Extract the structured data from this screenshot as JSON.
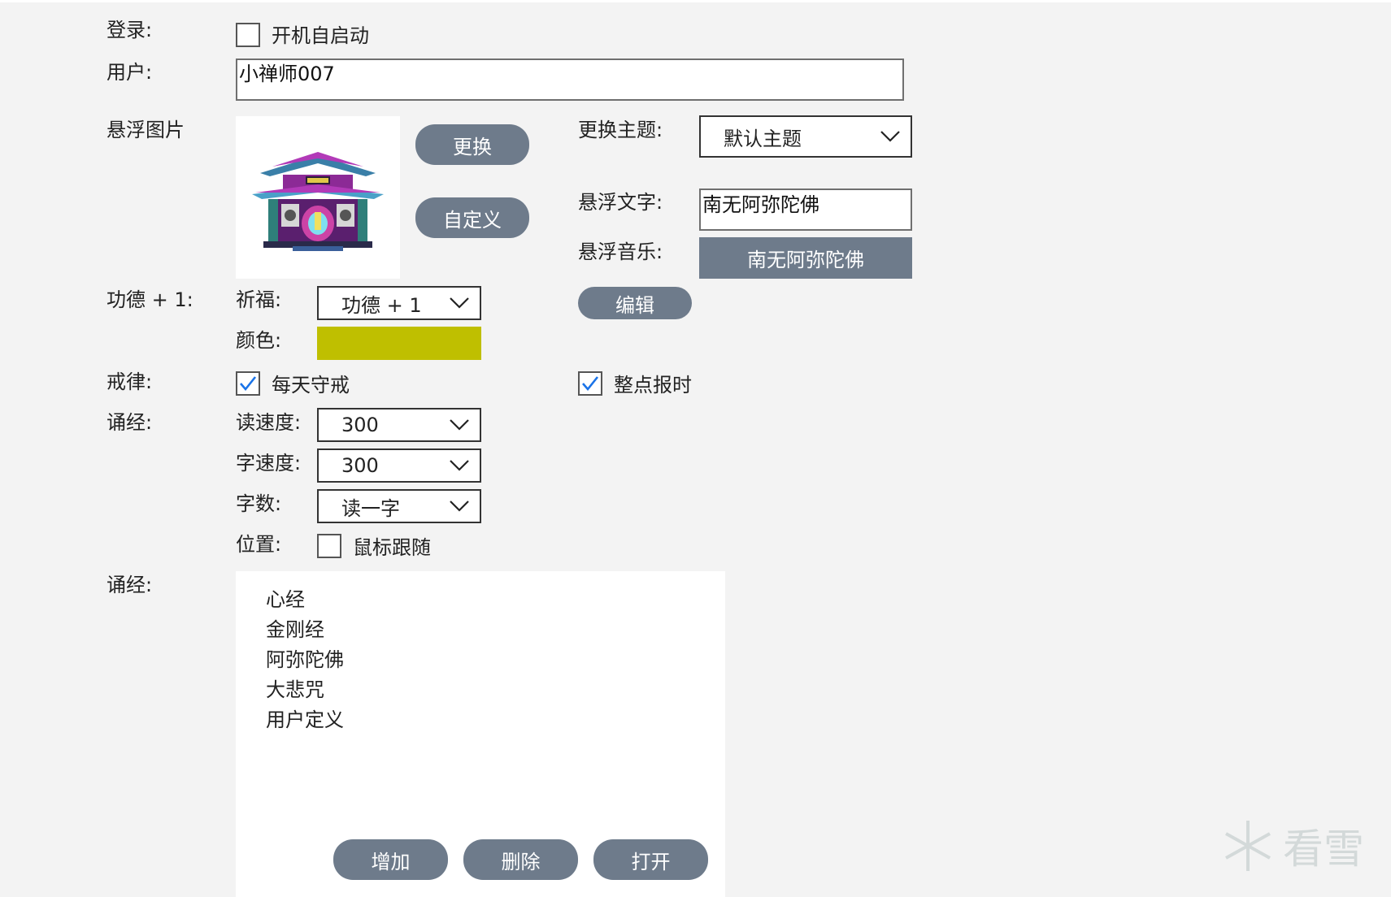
{
  "login": {
    "label": "登录:",
    "autostart_label": "开机自启动",
    "autostart_checked": false
  },
  "user": {
    "label": "用户:",
    "value": "小禅师007"
  },
  "float_image": {
    "label": "悬浮图片",
    "change_button": "更换",
    "custom_button": "自定义"
  },
  "theme": {
    "label": "更换主题:",
    "selected": "默认主题"
  },
  "float_text": {
    "label": "悬浮文字:",
    "value": "南无阿弥陀佛"
  },
  "float_music": {
    "label": "悬浮音乐:",
    "button": "南无阿弥陀佛"
  },
  "merit": {
    "label": "功德 + 1:",
    "pray_label": "祈福:",
    "pray_selected": "功德 + 1",
    "edit_button": "编辑",
    "color_label": "颜色:",
    "color_value": "#bfbf00"
  },
  "precepts": {
    "label": "戒律:",
    "daily_label": "每天守戒",
    "daily_checked": true,
    "hourly_label": "整点报时",
    "hourly_checked": true
  },
  "chant": {
    "label": "诵经:",
    "read_speed_label": "读速度:",
    "read_speed": "300",
    "char_speed_label": "字速度:",
    "char_speed": "300",
    "char_count_label": "字数:",
    "char_count": "读一字",
    "position_label": "位置:",
    "follow_mouse_label": "鼠标跟随",
    "follow_mouse_checked": false
  },
  "sutras": {
    "label": "诵经:",
    "items": [
      "心经",
      "金刚经",
      "阿弥陀佛",
      "大悲咒",
      "用户定义"
    ],
    "add_button": "增加",
    "delete_button": "删除",
    "open_button": "打开"
  },
  "watermark": {
    "text": "看雪"
  },
  "colors": {
    "accent": "#6e7b8b",
    "check": "#1a73e8",
    "merit_color": "#bfbf00"
  }
}
